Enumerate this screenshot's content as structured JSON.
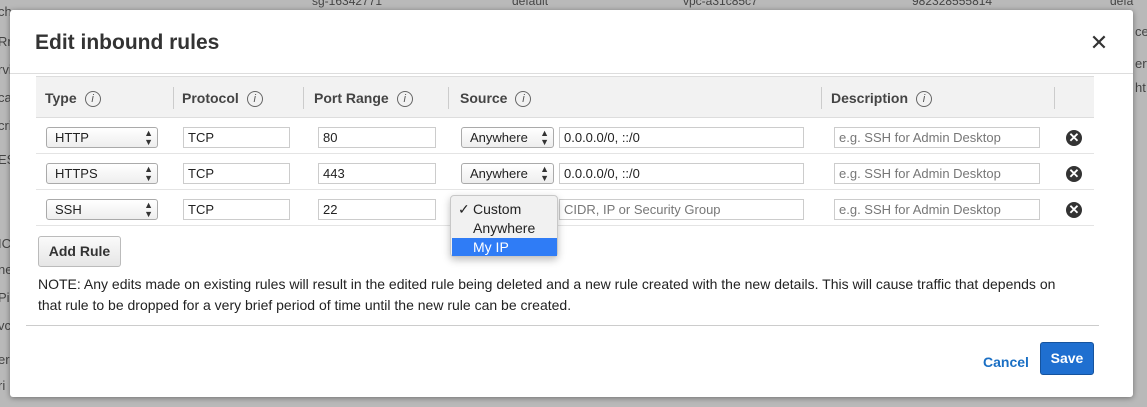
{
  "background": {
    "top_cells": [
      "sg-16342771",
      "default",
      "vpc-a31c85c7",
      "982328555814",
      "defa"
    ],
    "left_edge": [
      "ch",
      "Rr",
      "rvi",
      "ca",
      "cri",
      "ES",
      "",
      "ICI",
      "ne",
      "Pi",
      "vc",
      "er",
      "ri"
    ],
    "right_edge": [
      "ce",
      "ert",
      "ht"
    ]
  },
  "modal": {
    "title": "Edit inbound rules",
    "close_glyph": "✕"
  },
  "table": {
    "headers": {
      "type": "Type",
      "protocol": "Protocol",
      "port_range": "Port Range",
      "source": "Source",
      "description": "Description"
    },
    "info_glyph": "i",
    "rows": [
      {
        "type": "HTTP",
        "protocol": "TCP",
        "port": "80",
        "source_mode": "Anywhere",
        "source_value": "0.0.0.0/0, ::/0",
        "description_placeholder": "e.g. SSH for Admin Desktop"
      },
      {
        "type": "HTTPS",
        "protocol": "TCP",
        "port": "443",
        "source_mode": "Anywhere",
        "source_value": "0.0.0.0/0, ::/0",
        "description_placeholder": "e.g. SSH for Admin Desktop"
      },
      {
        "type": "SSH",
        "protocol": "TCP",
        "port": "22",
        "source_mode": "Custom",
        "source_placeholder": "CIDR, IP or Security Group",
        "description_placeholder": "e.g. SSH for Admin Desktop"
      }
    ],
    "remove_glyph": "✕"
  },
  "source_dropdown": {
    "options": [
      "Custom",
      "Anywhere",
      "My IP"
    ],
    "checked": "Custom",
    "highlighted": "My IP",
    "check_glyph": "✓"
  },
  "add_rule_label": "Add Rule",
  "note": "NOTE: Any edits made on existing rules will result in the edited rule being deleted and a new rule created with the new details. This will cause traffic that depends on that rule to be dropped for a very brief period of time until the new rule can be created.",
  "footer": {
    "cancel_label": "Cancel",
    "save_label": "Save"
  },
  "colors": {
    "accent": "#1f6fd0",
    "link": "#1a6fc4",
    "highlight": "#2f7cf6"
  }
}
